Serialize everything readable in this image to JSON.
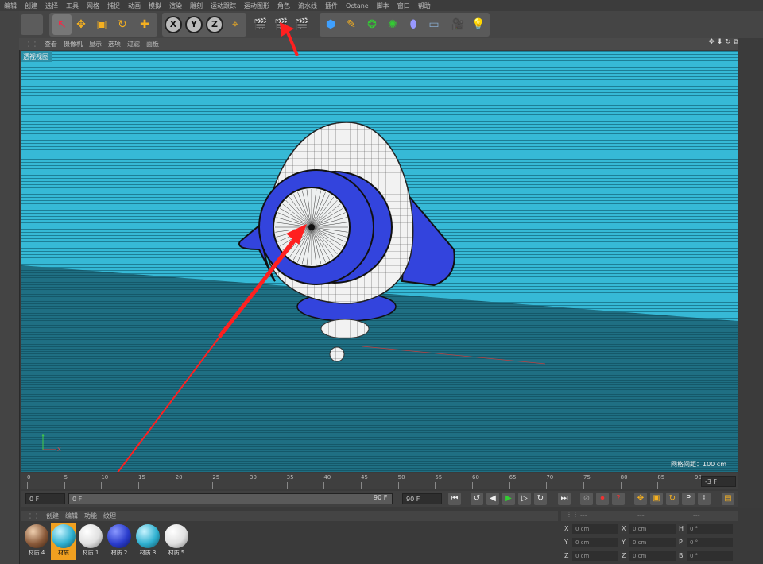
{
  "menu": [
    "编辑",
    "创建",
    "选择",
    "工具",
    "网格",
    "捕捉",
    "动画",
    "模拟",
    "渲染",
    "雕刻",
    "运动跟踪",
    "运动图形",
    "角色",
    "流水线",
    "插件",
    "Octane",
    "脚本",
    "窗口",
    "帮助"
  ],
  "toolbar": {
    "x": "X",
    "y": "Y",
    "z": "Z"
  },
  "viewport": {
    "menu": [
      "查看",
      "摄像机",
      "显示",
      "选项",
      "过滤",
      "面板"
    ],
    "label": "透视视图",
    "grid_label": "网格间距：100 cm",
    "axis_y": "Y",
    "axis_x": "X"
  },
  "timeline": {
    "ticks": [
      "0",
      "5",
      "10",
      "15",
      "20",
      "25",
      "30",
      "35",
      "40",
      "45",
      "50",
      "55",
      "60",
      "65",
      "70",
      "75",
      "80",
      "85",
      "90"
    ],
    "current": "-3 F"
  },
  "playbar": {
    "start": "0 F",
    "range_start": "0 F",
    "range_end": "90 F",
    "end": "90 F"
  },
  "materials": {
    "tabs": [
      "创建",
      "编辑",
      "功能",
      "纹理"
    ],
    "items": [
      {
        "label": "材质.4",
        "color": "#8a5a3a"
      },
      {
        "label": "材质",
        "color": "#2fb0d0"
      },
      {
        "label": "材质.1",
        "color": "#e8e8e8"
      },
      {
        "label": "材质.2",
        "color": "#2a3ccc"
      },
      {
        "label": "材质.3",
        "color": "#2fb0d0"
      },
      {
        "label": "材质.5",
        "color": "#e8e8e8"
      }
    ]
  },
  "coords": {
    "head": [
      "---",
      "---",
      "---"
    ],
    "rows": [
      {
        "a": "X",
        "av": "0 cm",
        "b": "X",
        "bv": "0 cm",
        "c": "H",
        "cv": "0 °"
      },
      {
        "a": "Y",
        "av": "0 cm",
        "b": "Y",
        "bv": "0 cm",
        "c": "P",
        "cv": "0 °"
      },
      {
        "a": "Z",
        "av": "0 cm",
        "b": "Z",
        "bv": "0 cm",
        "c": "B",
        "cv": "0 °"
      }
    ]
  },
  "colors": {
    "accent": "#f0a020",
    "arrow": "#ff2020",
    "rocket_blue": "#3344dd"
  }
}
